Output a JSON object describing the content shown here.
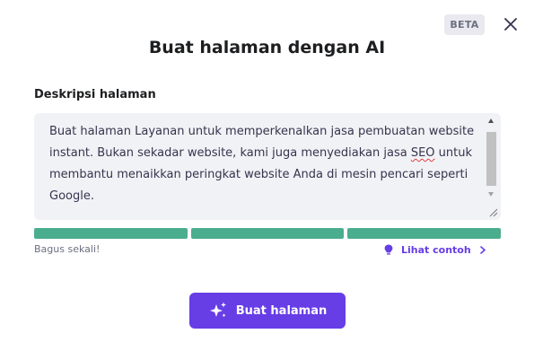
{
  "dialog": {
    "beta_badge": "BETA",
    "title": "Buat halaman dengan AI",
    "field_label": "Deskripsi halaman",
    "description": {
      "before_misspelling": "Buat halaman Layanan untuk memperkenalkan jasa pembuatan website instant. Bukan sekadar website, kami juga menyediakan jasa ",
      "misspelled_word": "SEO",
      "after_misspelling": " untuk membantu menaikkan peringkat website Anda di mesin pencari seperti Google."
    },
    "quality": {
      "label": "Bagus sekali!",
      "filled_segments": 3,
      "total_segments": 3,
      "color": "#4aad8e"
    },
    "example_link": "Lihat contoh",
    "submit_button": "Buat halaman"
  },
  "colors": {
    "primary": "#673de6",
    "title_text": "#1d1e20",
    "field_background": "#f1f2f6"
  },
  "icons": {
    "close": "close-icon",
    "lightbulb": "lightbulb-icon",
    "chevron": "chevron-right-icon",
    "sparkle": "sparkle-icon"
  }
}
